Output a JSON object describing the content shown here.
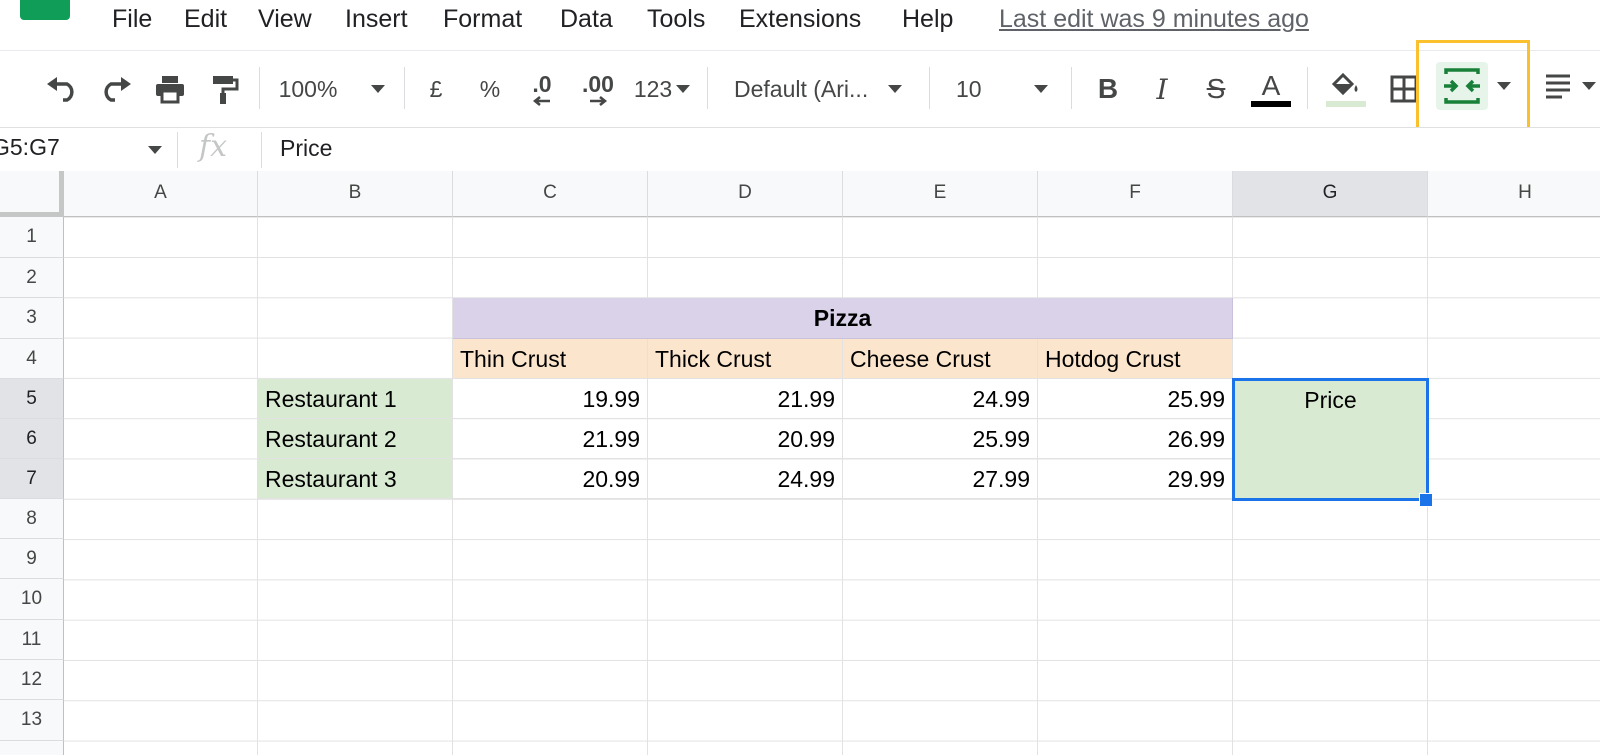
{
  "menu": {
    "items": [
      "File",
      "Edit",
      "View",
      "Insert",
      "Format",
      "Data",
      "Tools",
      "Extensions",
      "Help"
    ],
    "last_edit": "Last edit was 9 minutes ago"
  },
  "toolbar": {
    "zoom": "100%",
    "currency": "£",
    "percent": "%",
    "decrease_decimal": ".0",
    "increase_decimal": ".00",
    "more_formats": "123",
    "font": "Default (Ari...",
    "font_size": "10",
    "bold": "B",
    "italic": "I",
    "strikethrough": "S",
    "text_color_letter": "A",
    "text_color": "#000000",
    "fill_color": "#d9ead3",
    "highlight_color": "#fbc02d",
    "icons": [
      "undo-icon",
      "redo-icon",
      "print-icon",
      "paint-format-icon",
      "fill-color-icon",
      "borders-icon",
      "merge-cells-icon",
      "align-icon"
    ]
  },
  "formula_bar": {
    "name_box": "G5:G7",
    "fx": "fx",
    "content": "Price"
  },
  "sheet": {
    "columns": [
      "A",
      "B",
      "C",
      "D",
      "E",
      "F",
      "G",
      "H"
    ],
    "rows": [
      "1",
      "2",
      "3",
      "4",
      "5",
      "6",
      "7",
      "8",
      "9",
      "10",
      "11",
      "12",
      "13"
    ],
    "title": "Pizza",
    "headers": [
      "Thin Crust",
      "Thick Crust",
      "Cheese Crust",
      "Hotdog Crust"
    ],
    "restaurants": [
      "Restaurant 1",
      "Restaurant 2",
      "Restaurant 3"
    ],
    "prices": [
      [
        "19.99",
        "21.99",
        "24.99",
        "25.99"
      ],
      [
        "21.99",
        "20.99",
        "25.99",
        "26.99"
      ],
      [
        "20.99",
        "24.99",
        "27.99",
        "29.99"
      ]
    ],
    "selected_value": "Price",
    "colors": {
      "title_bg": "#d9d2e9",
      "header_bg": "#fce5cd",
      "restaurant_bg": "#d9ead3",
      "selection": "#1a73e8"
    }
  }
}
